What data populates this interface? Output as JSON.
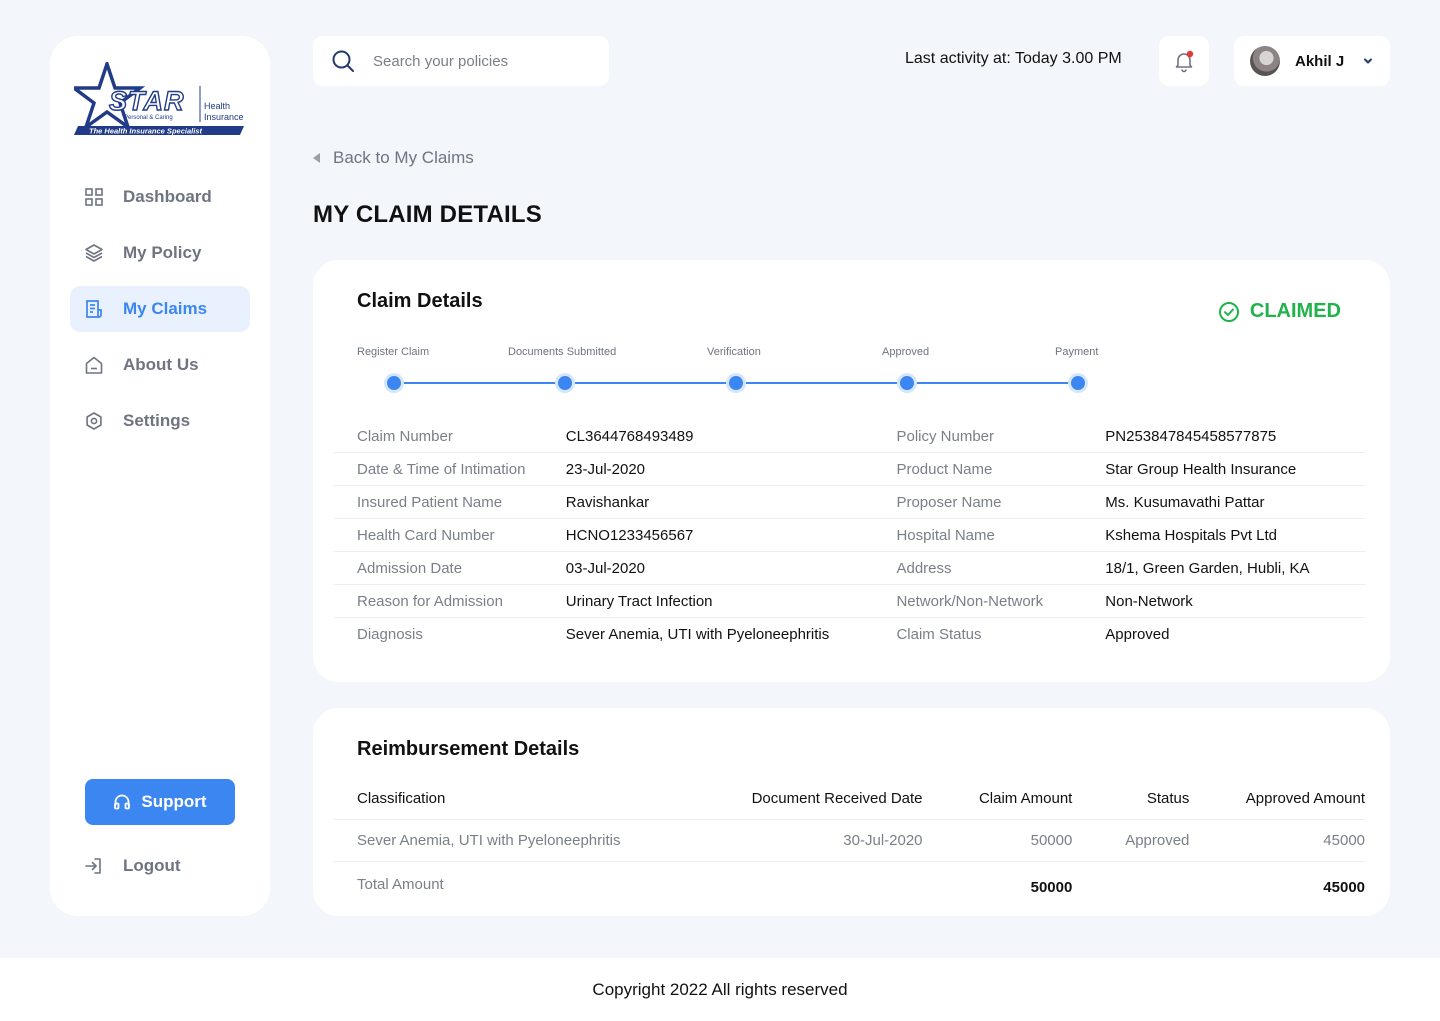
{
  "brand": {
    "logo_word": "STAR",
    "logo_side_top": "Health",
    "logo_side_bottom": "Insurance",
    "logo_small": "Personal & Caring",
    "logo_tagline": "The Health Insurance Specialist",
    "colors": {
      "navy": "#213b88",
      "accent": "#3c86f1",
      "success": "#22b24c"
    }
  },
  "sidebar": {
    "items": [
      {
        "label": "Dashboard",
        "icon": "grid-icon",
        "active": false
      },
      {
        "label": "My Policy",
        "icon": "layers-icon",
        "active": false
      },
      {
        "label": "My Claims",
        "icon": "document-icon",
        "active": true
      },
      {
        "label": "About Us",
        "icon": "home-icon",
        "active": false
      },
      {
        "label": "Settings",
        "icon": "gear-icon",
        "active": false
      }
    ],
    "support_label": "Support",
    "logout_label": "Logout"
  },
  "header": {
    "search_placeholder": "Search your policies",
    "last_activity": "Last activity at: Today 3.00 PM",
    "user_name": "Akhil J"
  },
  "page": {
    "back_label": "Back to My Claims",
    "title": "MY CLAIM DETAILS"
  },
  "claim": {
    "title": "Claim Details",
    "status": "CLAIMED",
    "steps": [
      "Register Claim",
      "Documents Submitted",
      "Verification",
      "Approved",
      "Payment"
    ],
    "rows": [
      {
        "l1": "Claim Number",
        "v1": "CL3644768493489",
        "l2": "Policy Number",
        "v2": "PN253847845458577875"
      },
      {
        "l1": "Date & Time of Intimation",
        "v1": "23-Jul-2020",
        "l2": "Product Name",
        "v2": "Star Group Health Insurance"
      },
      {
        "l1": "Insured Patient Name",
        "v1": "Ravishankar",
        "l2": "Proposer Name",
        "v2": "Ms. Kusumavathi Pattar"
      },
      {
        "l1": "Health Card Number",
        "v1": "HCNO1233456567",
        "l2": "Hospital Name",
        "v2": "Kshema Hospitals Pvt Ltd"
      },
      {
        "l1": "Admission Date",
        "v1": "03-Jul-2020",
        "l2": "Address",
        "v2": "18/1, Green Garden, Hubli, KA"
      },
      {
        "l1": "Reason for Admission",
        "v1": "Urinary Tract Infection",
        "l2": "Network/Non-Network",
        "v2": "Non-Network"
      },
      {
        "l1": "Diagnosis",
        "v1": "Sever Anemia, UTI with Pyeloneephritis",
        "l2": "Claim Status",
        "v2": "Approved"
      }
    ]
  },
  "reimbursement": {
    "title": "Reimbursement Details",
    "headers": [
      "Classification",
      "Document Received Date",
      "Claim Amount",
      "Status",
      "Approved Amount"
    ],
    "rows": [
      {
        "classification": "Sever Anemia, UTI with Pyeloneephritis",
        "date": "30-Jul-2020",
        "claim_amount": "50000",
        "status": "Approved",
        "approved_amount": "45000"
      }
    ],
    "total_label": "Total Amount",
    "total_claim": "50000",
    "total_approved": "45000"
  },
  "footer": {
    "copyright": "Copyright 2022 All rights reserved"
  }
}
